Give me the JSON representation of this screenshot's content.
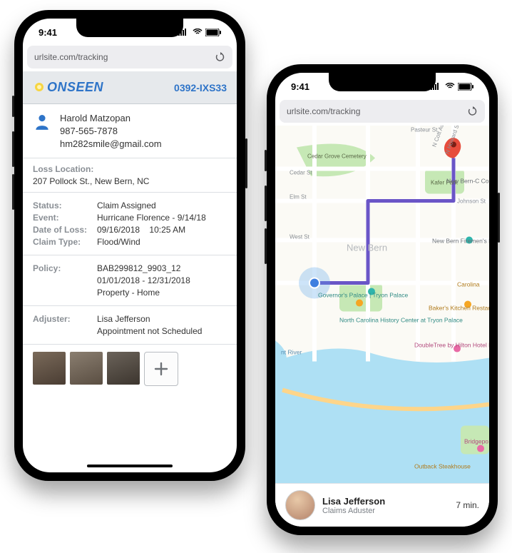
{
  "status_bar": {
    "time": "9:41"
  },
  "url_bar": {
    "url": "urlsite.com/tracking"
  },
  "left": {
    "logo_text": "ONSEEN",
    "claim_number": "0392-IXS33",
    "contact": {
      "name": "Harold Matzopan",
      "phone": "987-565-7878",
      "email": "hm282smile@gmail.com"
    },
    "loss_location_label": "Loss  Location:",
    "loss_location_value": "207 Pollock St., New Bern, NC",
    "details": {
      "status_label": "Status:",
      "status_value": "Claim Assigned",
      "event_label": "Event:",
      "event_value": "Hurricane Florence - 9/14/18",
      "dol_label": "Date of Loss:",
      "dol_value": "09/16/2018    10:25 AM",
      "claimtype_label": "Claim Type:",
      "claimtype_value": "Flood/Wind"
    },
    "policy": {
      "label": "Policy:",
      "number": "BAB299812_9903_12",
      "period": "01/01/2018 - 12/31/2018",
      "type": "Property - Home"
    },
    "adjuster": {
      "label": "Adjuster:",
      "name": "Lisa Jefferson",
      "status": "Appointment not Scheduled"
    }
  },
  "right": {
    "map_labels": {
      "cemetery": "Cedar Grove Cemetery",
      "kafer": "Kafer Park",
      "county": "New Bern-C\nCounty Publi",
      "firemen": "New Bern Firemen's Museu",
      "newbern": "New Bern",
      "tryon": "Governor's Palace\n| Tryon Palace",
      "history": "North Carolina History\nCenter at Tryon Palace",
      "carolina": "Carolina",
      "bakers": "Baker's Kitchen\nRestaurant & Bakery",
      "doubletree": "DoubleTree by\nHilton Hotel New Bern",
      "outback": "Outback Steakhouse",
      "river": "nt River",
      "street_elm": "Elm St",
      "street_cedar": "Cedar St",
      "street_johnson": "Johnson St",
      "street_west": "West St",
      "street_pasteur": "Pasteur St",
      "street_howard": "N Howard St",
      "street_ncott": "N Cott Ave",
      "bridgepo": "Bridgepo\nHotel"
    },
    "card": {
      "name": "Lisa Jefferson",
      "role": "Claims Aduster",
      "eta": "7 min."
    }
  }
}
